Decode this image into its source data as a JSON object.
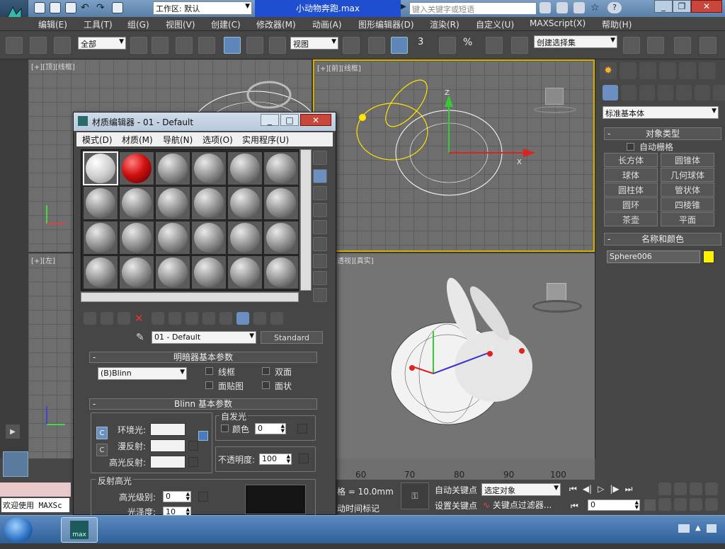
{
  "app": {
    "workspace_label": "工作区: 默认",
    "file_title": "小动物奔跑.max",
    "search_placeholder": "键入关键字或短语"
  },
  "menu": [
    "编辑(E)",
    "工具(T)",
    "组(G)",
    "视图(V)",
    "创建(C)",
    "修改器(M)",
    "动画(A)",
    "图形编辑器(D)",
    "渲染(R)",
    "自定义(U)",
    "MAXScript(X)",
    "帮助(H)"
  ],
  "toolbar": {
    "selection_filter": "全部",
    "ref_coord": "视图",
    "named_selection": "创建选择集",
    "snap_num": "3"
  },
  "viewports": {
    "top_label": "[+][顶][线框]",
    "front_label": "[+][前][线框]",
    "left_label": "[+][左]",
    "persp_label": "透视][真实]",
    "axis_z": "Z",
    "axis_x": "X",
    "axis_y": "Y"
  },
  "cmdpanel": {
    "category": "标准基本体",
    "object_type_header": "对象类型",
    "autogrid_label": "自动栅格",
    "buttons": [
      "长方体",
      "圆锥体",
      "球体",
      "几何球体",
      "圆柱体",
      "管状体",
      "圆环",
      "四棱锥",
      "茶壶",
      "平面"
    ],
    "name_color_header": "名称和颜色",
    "object_name": "Sphere006",
    "object_color": "#ffef00"
  },
  "material_editor": {
    "title": "材质编辑器 - 01 - Default",
    "menu": [
      "模式(D)",
      "材质(M)",
      "导航(N)",
      "选项(O)",
      "实用程序(U)"
    ],
    "material_name": "01 - Default",
    "material_type": "Standard",
    "shader_header": "明暗器基本参数",
    "shader_value": "(B)Blinn",
    "wire_label": "线框",
    "two_sided_label": "双面",
    "facemap_label": "面贴图",
    "faceted_label": "面状",
    "blinn_header": "Blinn 基本参数",
    "self_illum_label": "自发光",
    "color_label": "颜色",
    "self_illum_value": "0",
    "ambient_label": "环境光:",
    "diffuse_label": "漫反射:",
    "specular_label": "高光反射:",
    "opacity_label": "不透明度:",
    "opacity_value": "100",
    "spec_highlights_label": "反射高光",
    "spec_level_label": "高光级别:",
    "spec_level_value": "0",
    "glossiness_label": "光泽度:",
    "glossiness_value": "10"
  },
  "timeline": {
    "ticks": [
      "60",
      "70",
      "80",
      "90",
      "100"
    ]
  },
  "status": {
    "grid_text": "格 = 10.0mm",
    "add_time_tag": "动时间标记",
    "auto_key": "自动关键点",
    "set_key": "设置关键点",
    "selected_objects": "选定对象",
    "key_filters": "关键点过滤器...",
    "frame_value": "0",
    "welcome_text": "欢迎使用 MAXSc"
  },
  "taskbar": {
    "app_icon": "max"
  }
}
